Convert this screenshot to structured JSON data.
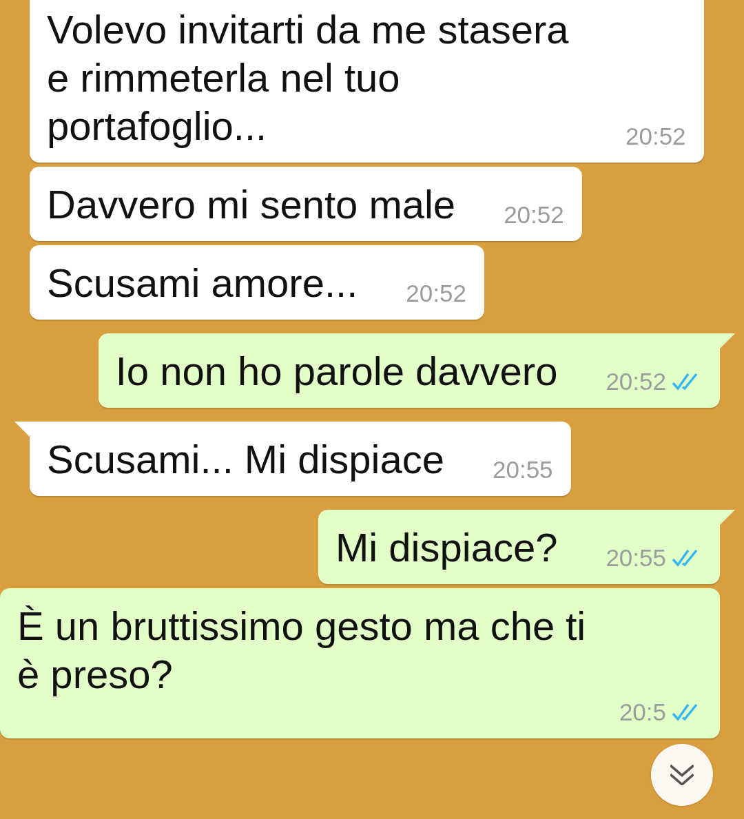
{
  "messages": [
    {
      "kind": "incoming",
      "tail": false,
      "text": "Volevo invitarti da me stasera e rimmeterla nel tuo portafoglio...",
      "time": "20:52"
    },
    {
      "kind": "incoming",
      "tail": false,
      "text": "Davvero mi sento male",
      "time": "20:52"
    },
    {
      "kind": "incoming",
      "tail": false,
      "text": "Scusami amore...",
      "time": "20:52"
    },
    {
      "kind": "outgoing",
      "tail": true,
      "text": "Io non ho parole davvero",
      "time": "20:52",
      "read": true
    },
    {
      "kind": "incoming",
      "tail": true,
      "text": "Scusami... Mi dispiace",
      "time": "20:55"
    },
    {
      "kind": "outgoing",
      "tail": true,
      "text": "Mi dispiace?",
      "time": "20:55",
      "read": true
    },
    {
      "kind": "outgoing",
      "tail": false,
      "text": "È un bruttissimo gesto ma che ti è preso?",
      "time": "20:5",
      "read": true
    }
  ]
}
